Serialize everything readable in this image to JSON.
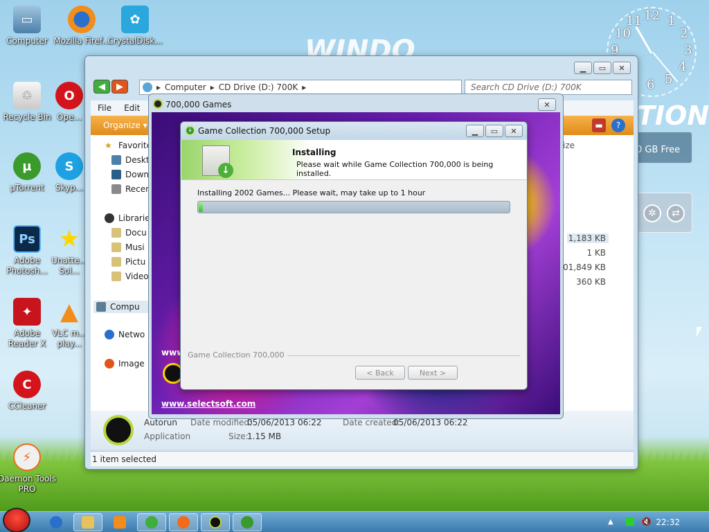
{
  "desktop": {
    "icons": [
      {
        "label": "Computer"
      },
      {
        "label": "Mozilla Firef..."
      },
      {
        "label": "CrystalDisk..."
      },
      {
        "label": "Recycle Bin"
      },
      {
        "label": "Ope..."
      },
      {
        "label": "µTorrent"
      },
      {
        "label": "Skyp..."
      },
      {
        "label": "Adobe Photosh..."
      },
      {
        "label": "Unatte... Sol..."
      },
      {
        "label": "Adobe Reader X"
      },
      {
        "label": "VLC m... play..."
      },
      {
        "label": "CCleaner"
      },
      {
        "label": "Daemon Tools PRO"
      }
    ],
    "logo_text": "WINDO",
    "edition_text": "TION",
    "gadget_free_text": "0 GB Free",
    "clock_numbers": [
      "12",
      "1",
      "2",
      "3",
      "4",
      "5",
      "6",
      "9",
      "10",
      "11"
    ]
  },
  "explorer": {
    "address_parts": [
      "Computer",
      "CD Drive (D:) 700K"
    ],
    "search_placeholder": "Search CD Drive (D:) 700K",
    "menu": [
      "File",
      "Edit"
    ],
    "organize_label": "Organize ▾",
    "size_header": "ize",
    "nav": {
      "favorites": "Favorite",
      "desktop": "Deskt",
      "downloads": "Down",
      "recent": "Recen",
      "libraries": "Librarie",
      "documents": "Docu",
      "music": "Musi",
      "pictures": "Pictu",
      "videos": "Video",
      "computer": "Compu",
      "network": "Netwo",
      "image": "Image"
    },
    "sizes": [
      "1,183 KB",
      "1 KB",
      "201,849 KB",
      "360 KB"
    ],
    "details": {
      "name": "Autorun",
      "type": "Application",
      "modified_label": "Date modified:",
      "modified_value": "05/06/2013 06:22",
      "created_label": "Date created:",
      "created_value": "05/06/2013 06:22",
      "size_label": "Size:",
      "size_value": "1.15 MB"
    },
    "status": "1 item selected"
  },
  "game_window": {
    "title": "700,000 Games",
    "url_top": "www.",
    "url": "www.selectsoft.com"
  },
  "setup": {
    "title": "Game Collection 700,000 Setup",
    "heading": "Installing",
    "subheading": "Please wait while Game Collection 700,000 is being installed.",
    "status": "Installing 2002 Games... Please wait, may take up to 1 hour",
    "progress_percent": 1,
    "brand": "Game Collection 700,000",
    "back_label": "< Back",
    "next_label": "Next >"
  },
  "taskbar": {
    "time": "22:32"
  },
  "colors": {
    "cmdbar": "#e99a2a",
    "progress_fill": "#3cbf28",
    "taskbar": "#4a8cc0"
  }
}
